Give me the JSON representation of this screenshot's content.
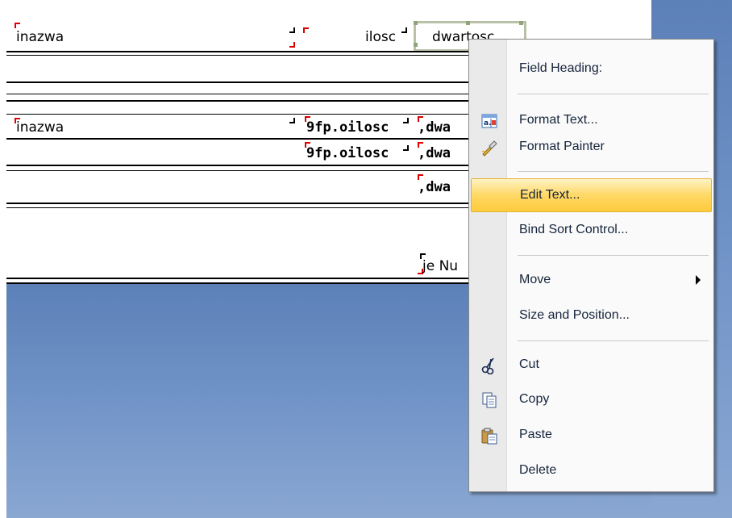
{
  "report": {
    "header_nazwa": "inazwa",
    "header_ilosc": "ilosc",
    "header_wartosc": "dwartosc",
    "row_nazwa": "inazwa",
    "row_ilosc_1": "9fp.oilosc",
    "row_ilosc_2": "9fp.oilosc",
    "row_dwa_1": ",dwa",
    "row_dwa_2": ",dwa",
    "row_dwa_3": ",dwa",
    "footer_page": "je Nu"
  },
  "context_menu": {
    "field_heading": "Field Heading:",
    "format_text": "Format Text...",
    "format_painter": "Format Painter",
    "edit_text": "Edit Text...",
    "bind_sort_control": "Bind Sort Control...",
    "move": "Move",
    "size_and_position": "Size and Position...",
    "cut": "Cut",
    "copy": "Copy",
    "paste": "Paste",
    "delete": "Delete"
  },
  "colors": {
    "highlight": "#ffd865",
    "background_blue": "#6f92c6",
    "marker_red": "#dd0000"
  },
  "icons": [
    "format-text-icon",
    "format-painter-icon",
    "scissors-icon",
    "copy-icon",
    "paste-icon",
    "submenu-arrow-icon"
  ]
}
